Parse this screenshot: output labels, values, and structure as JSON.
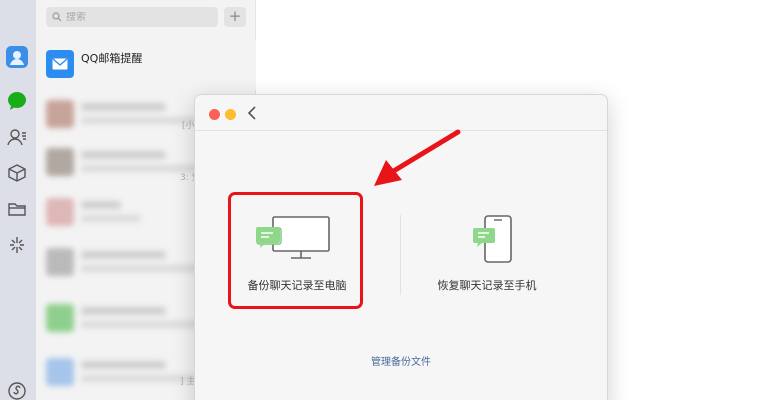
{
  "sidebar": {
    "search_placeholder": "搜索",
    "add_label": "+",
    "mail_item_title": "QQ邮箱提醒"
  },
  "background": {
    "frag1": "[小",
    "frag2": "3: 免",
    "frag3": "] 主"
  },
  "dialog": {
    "option_pc_label": "备份聊天记录至电脑",
    "option_phone_label": "恢复聊天记录至手机",
    "manage_link": "管理备份文件"
  },
  "colors": {
    "accent": "#2d8cf0",
    "wechat_green": "#1aad19",
    "highlight_red": "#e8141a",
    "traffic_close": "#fe5f57",
    "traffic_min": "#febc2e"
  },
  "icons": [
    "user-avatar-icon",
    "chat-icon",
    "contacts-icon",
    "cube-icon",
    "folder-icon",
    "moments-icon",
    "mini-program-icon",
    "search-icon",
    "mail-icon",
    "back-chevron-icon",
    "computer-chat-icon",
    "phone-chat-icon",
    "red-arrow-icon"
  ]
}
